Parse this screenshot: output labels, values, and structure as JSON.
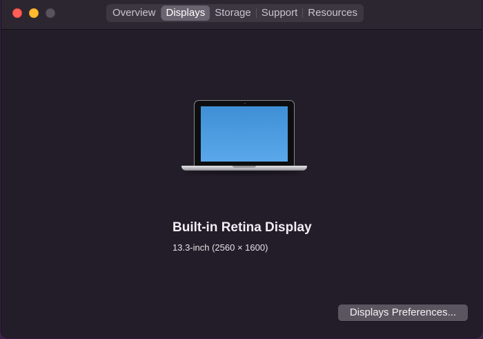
{
  "window": {
    "tabs": [
      {
        "label": "Overview",
        "active": false
      },
      {
        "label": "Displays",
        "active": true
      },
      {
        "label": "Storage",
        "active": false
      },
      {
        "label": "Support",
        "active": false
      },
      {
        "label": "Resources",
        "active": false
      }
    ]
  },
  "display": {
    "icon": "laptop-icon",
    "name": "Built-in Retina Display",
    "spec": "13.3-inch (2560 × 1600)"
  },
  "actions": {
    "preferences_label": "Displays Preferences..."
  },
  "colors": {
    "background": "#231d29",
    "titlebar": "#2c2631",
    "close": "#ff5f57",
    "minimize": "#febc2e",
    "zoom": "#58535c",
    "active_tab": "#6a6470",
    "button": "#5b5560"
  }
}
